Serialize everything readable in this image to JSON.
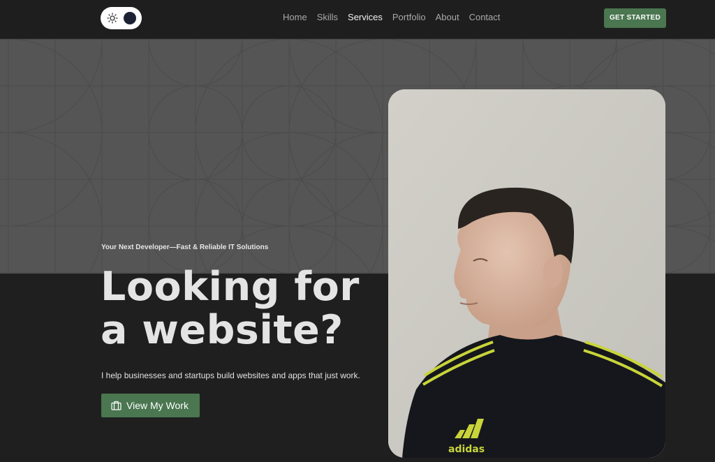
{
  "nav": {
    "theme_toggle": {
      "icon": "sun-icon",
      "state": "dark"
    },
    "links": [
      {
        "label": "Home",
        "active": false
      },
      {
        "label": "Skills",
        "active": false
      },
      {
        "label": "Services",
        "active": true
      },
      {
        "label": "Portfolio",
        "active": false
      },
      {
        "label": "About",
        "active": false
      },
      {
        "label": "Contact",
        "active": false
      }
    ],
    "cta_label": "GET STARTED"
  },
  "hero": {
    "tagline": "Your Next Developer—Fast & Reliable IT Solutions",
    "headline_line1": "Looking for",
    "headline_line2": "a website?",
    "subtitle": "I help businesses and startups build websites and apps that just work.",
    "button": {
      "label": "View My Work",
      "icon": "briefcase-icon"
    },
    "photo": {
      "shirt_logo": "adidas"
    }
  },
  "colors": {
    "accent": "#4a7650",
    "page_bg": "#1f1f1f",
    "pattern_bg": "#555555"
  }
}
